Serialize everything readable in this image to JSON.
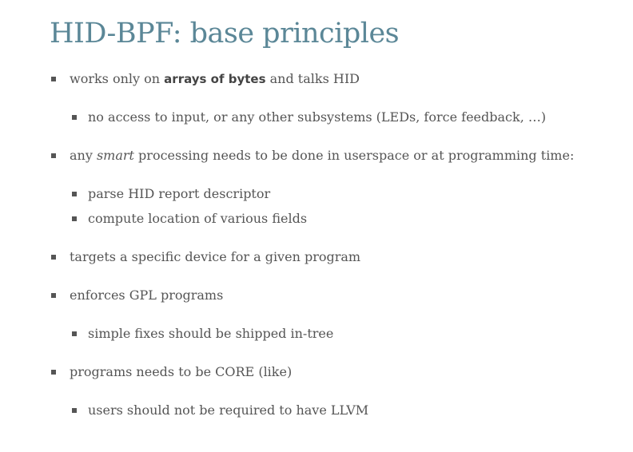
{
  "title": "HID-BPF: base principles",
  "items": [
    {
      "level": 1,
      "segments": [
        {
          "t": "works only on "
        },
        {
          "t": "arrays of bytes",
          "s": "b"
        },
        {
          "t": " and talks HID"
        }
      ]
    },
    {
      "level": 2,
      "segments": [
        {
          "t": "no access to input, or any other subsystems (LEDs, force feedback, …)"
        }
      ]
    },
    {
      "level": 1,
      "segments": [
        {
          "t": "any "
        },
        {
          "t": "smart",
          "s": "i"
        },
        {
          "t": " processing needs to be done in userspace or at programming time:"
        }
      ]
    },
    {
      "level": 2,
      "segments": [
        {
          "t": "parse HID report descriptor"
        }
      ]
    },
    {
      "level": 2,
      "segments": [
        {
          "t": "compute location of various fields"
        }
      ]
    },
    {
      "level": 1,
      "segments": [
        {
          "t": "targets a specific device for a given program"
        }
      ]
    },
    {
      "level": 1,
      "segments": [
        {
          "t": "enforces GPL programs"
        }
      ]
    },
    {
      "level": 2,
      "segments": [
        {
          "t": "simple fixes should be shipped in-tree"
        }
      ]
    },
    {
      "level": 1,
      "segments": [
        {
          "t": "programs needs to be CORE (like)"
        }
      ]
    },
    {
      "level": 2,
      "segments": [
        {
          "t": "users should not be required to have LLVM"
        }
      ]
    }
  ]
}
